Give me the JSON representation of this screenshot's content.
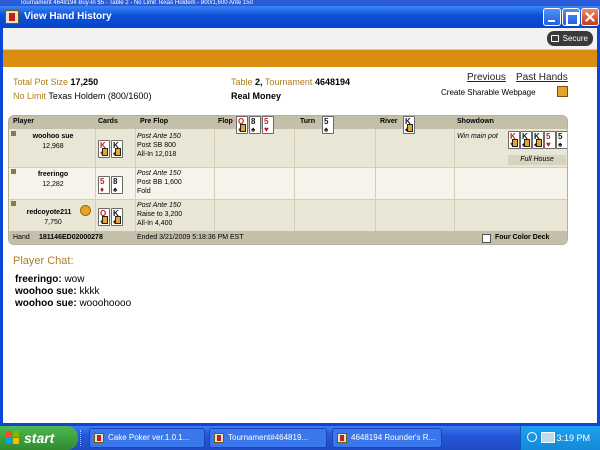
{
  "background_window": {
    "title": "Tournament 4648194 Buy-In $5 - Table 2 - No Limit Texas Holdem - 800/1,600 Ante 150"
  },
  "window": {
    "title": "View Hand History"
  },
  "secure_label": "Secure",
  "summary": {
    "pot_label": "Total Pot Size",
    "pot_value": "17,250",
    "game_limit": "No Limit",
    "game_name": "Texas Holdem",
    "blinds": "(800/1600)",
    "table_label": "Table",
    "table_value": "2,",
    "tournament_label": "Tournament",
    "tournament_value": "4648194",
    "money_type": "Real Money",
    "previous_link": "Previous",
    "past_hands_link": "Past Hands",
    "share_link": "Create Sharable Webpage"
  },
  "columns": {
    "player": "Player",
    "cards": "Cards",
    "preflop": "Pre Flop",
    "flop": "Flop",
    "turn": "Turn",
    "river": "River",
    "showdown": "Showdown"
  },
  "board": {
    "flop": [
      {
        "rank": "Q",
        "suit": "♦",
        "color": "red"
      },
      {
        "rank": "8",
        "suit": "♠",
        "color": "black"
      },
      {
        "rank": "5",
        "suit": "♥",
        "color": "red"
      }
    ],
    "turn": {
      "rank": "5",
      "suit": "♠",
      "color": "black"
    },
    "river": {
      "rank": "K",
      "suit": "♣",
      "color": "black"
    }
  },
  "players": [
    {
      "name": "woohoo sue",
      "chips": "12,968",
      "cards": [
        {
          "rank": "K",
          "suit": "♥",
          "color": "red"
        },
        {
          "rank": "K",
          "suit": "♠",
          "color": "black"
        }
      ],
      "actions": [
        "Post Ante 150",
        "Post SB 800",
        "All-In 12,018"
      ],
      "showdown_label": "Win main pot",
      "best_hand": [
        {
          "rank": "K",
          "suit": "♥",
          "color": "red"
        },
        {
          "rank": "K",
          "suit": "♠",
          "color": "black"
        },
        {
          "rank": "K",
          "suit": "♣",
          "color": "black"
        },
        {
          "rank": "5",
          "suit": "♥",
          "color": "red"
        },
        {
          "rank": "5",
          "suit": "♠",
          "color": "black"
        }
      ],
      "hand_name": "Full House"
    },
    {
      "name": "freeringo",
      "chips": "12,282",
      "cards": [
        {
          "rank": "5",
          "suit": "♦",
          "color": "red"
        },
        {
          "rank": "8",
          "suit": "♠",
          "color": "black"
        }
      ],
      "actions": [
        "Post Ante 150",
        "Post BB 1,600",
        "Fold"
      ]
    },
    {
      "name": "redcoyote211",
      "chips": "7,750",
      "cards": [
        {
          "rank": "Q",
          "suit": "♦",
          "color": "red"
        },
        {
          "rank": "K",
          "suit": "♠",
          "color": "black"
        }
      ],
      "actions": [
        "Post Ante 150",
        "Raise to 3,200",
        "All-In 4,400"
      ]
    }
  ],
  "footer": {
    "hand_label": "Hand",
    "hand_id": "181146ED02000278",
    "ended": "Ended 3/21/2009 5:18:36 PM EST",
    "four_color_label": "Four Color Deck"
  },
  "chat": {
    "heading": "Player Chat:",
    "lines": [
      {
        "user": "freeringo:",
        "text": " wow"
      },
      {
        "user": "woohoo sue:",
        "text": " kkkk"
      },
      {
        "user": "woohoo sue:",
        "text": " woooh​oooo"
      }
    ]
  },
  "taskbar": {
    "start_label": "start",
    "items": [
      "Cake Poker ver.1.0.1...",
      "Tournament#464819...",
      "4648194 Rounder's R..."
    ],
    "clock": "3:19 PM"
  },
  "colors": {
    "accent_orange": "#d98e11",
    "label_gold": "#b07e1e",
    "title_blue": "#0c4fd8"
  }
}
